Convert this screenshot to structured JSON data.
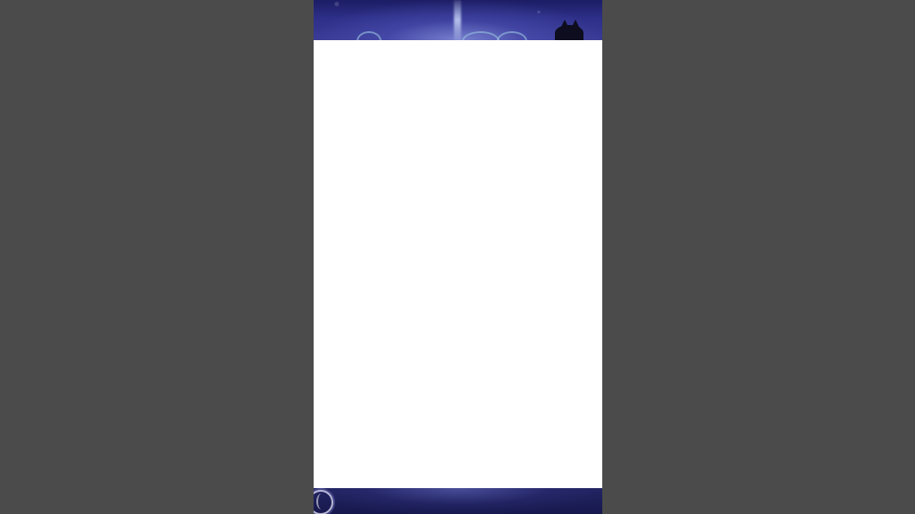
{
  "screen": {
    "background_color": "#4b4b4b",
    "panel_color": "#ffffff",
    "artwork_palette": [
      "#1c1d64",
      "#2d2f88",
      "#3a3b95",
      "#17184c"
    ]
  },
  "phone": {
    "top_artwork": {
      "icons": {
        "creature": "creature-icon",
        "beam": "light-beam-icon",
        "swirls": [
          "swirl-icon",
          "swirl-icon",
          "swirl-icon"
        ]
      }
    },
    "content_panel": {
      "text": ""
    },
    "bottom_artwork": {
      "icons": {
        "ring": "ring-icon"
      }
    }
  }
}
